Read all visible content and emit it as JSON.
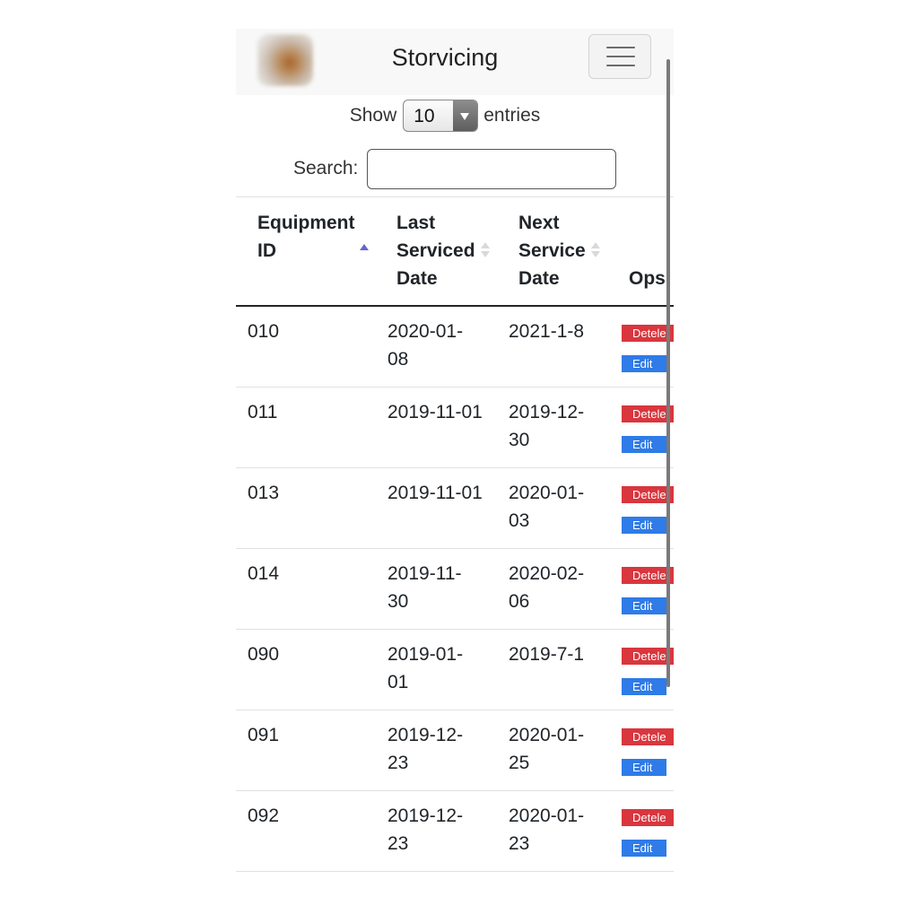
{
  "navbar": {
    "brand": "Storvicing",
    "logo_icon": "app-logo-icon",
    "menu_icon": "hamburger-menu-icon"
  },
  "length": {
    "show_label": "Show",
    "value": "10",
    "entries_label": "entries"
  },
  "search": {
    "label": "Search:",
    "value": "",
    "placeholder": ""
  },
  "table": {
    "headers": [
      {
        "lines": [
          "Equipment",
          "ID"
        ],
        "sort": "ascending"
      },
      {
        "lines": [
          "Last",
          "Serviced",
          "Date"
        ],
        "sort": "none"
      },
      {
        "lines": [
          "Next",
          "Service",
          "Date"
        ],
        "sort": "none"
      },
      {
        "lines": [
          "Ops"
        ],
        "sort": ""
      }
    ],
    "rows": [
      {
        "id": "010",
        "last": [
          "2020-01-",
          "08"
        ],
        "next": [
          "2021-1-8"
        ],
        "delete": "Detele",
        "edit": "Edit"
      },
      {
        "id": "011",
        "last": [
          "2019-11-01"
        ],
        "next": [
          "2019-12-",
          "30"
        ],
        "delete": "Detele",
        "edit": "Edit"
      },
      {
        "id": "013",
        "last": [
          "2019-11-01"
        ],
        "next": [
          "2020-01-",
          "03"
        ],
        "delete": "Detele",
        "edit": "Edit"
      },
      {
        "id": "014",
        "last": [
          "2019-11-",
          "30"
        ],
        "next": [
          "2020-02-",
          "06"
        ],
        "delete": "Detele",
        "edit": "Edit"
      },
      {
        "id": "090",
        "last": [
          "2019-01-",
          "01"
        ],
        "next": [
          "2019-7-1"
        ],
        "delete": "Detele",
        "edit": "Edit"
      },
      {
        "id": "091",
        "last": [
          "2019-12-",
          "23"
        ],
        "next": [
          "2020-01-",
          "25"
        ],
        "delete": "Detele",
        "edit": "Edit"
      },
      {
        "id": "092",
        "last": [
          "2019-12-",
          "23"
        ],
        "next": [
          "2020-01-",
          "23"
        ],
        "delete": "Detele",
        "edit": "Edit"
      }
    ]
  },
  "colors": {
    "delete": "#d9363e",
    "edit": "#2f7be7",
    "sort_active": "#6366d1",
    "navbar_bg": "#f8f8f8"
  }
}
